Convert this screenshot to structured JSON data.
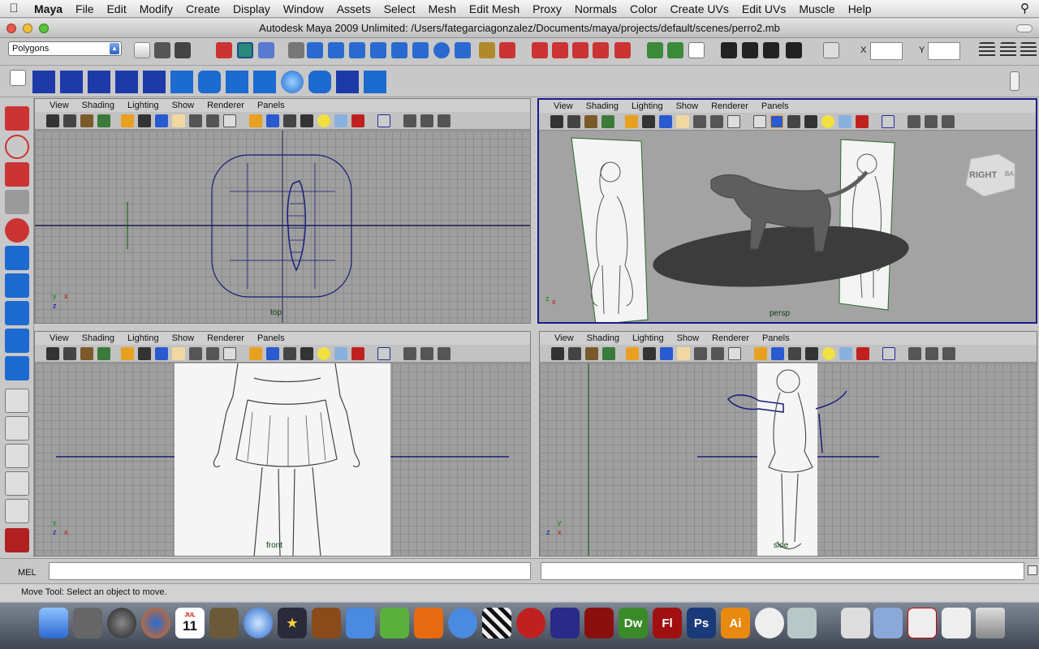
{
  "menubar": {
    "app": "Maya",
    "items": [
      "File",
      "Edit",
      "Modify",
      "Create",
      "Display",
      "Window",
      "Assets",
      "Select",
      "Mesh",
      "Edit Mesh",
      "Proxy",
      "Normals",
      "Color",
      "Create UVs",
      "Edit UVs",
      "Muscle",
      "Help"
    ]
  },
  "window": {
    "title": "Autodesk Maya 2009 Unlimited: /Users/fategarciagonzalez/Documents/maya/projects/default/scenes/perro2.mb"
  },
  "toolbar": {
    "mode": "Polygons",
    "x_label": "X",
    "y_label": "Y"
  },
  "panel_menu": [
    "View",
    "Shading",
    "Lighting",
    "Show",
    "Renderer",
    "Panels"
  ],
  "panels": {
    "top": "top",
    "persp": "persp",
    "front": "front",
    "side": "side"
  },
  "viewcube": {
    "right": "RIGHT",
    "back": "BA"
  },
  "command": {
    "mel_label": "MEL"
  },
  "status": {
    "help": "Move Tool: Select an object to move."
  },
  "dock": {
    "calendar_month": "JUL",
    "calendar_day": "11",
    "dw": "Dw",
    "fl": "Fl",
    "ps": "Ps",
    "ai": "Ai"
  },
  "colors": {
    "wire": "#1b1b7a",
    "active_border": "#1c1c8a",
    "viewport_bg": "#9f9f9f",
    "grid": "#8c8c8c"
  }
}
